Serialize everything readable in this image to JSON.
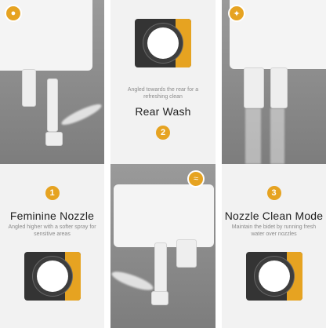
{
  "panels": {
    "feminine": {
      "number": "1",
      "title": "Feminine Nozzle",
      "description": "Angled higher with a softer spray for sensitive areas",
      "badge_icon": "water-drop-icon"
    },
    "rear": {
      "number": "2",
      "title": "Rear Wash",
      "description": "Angled towards the rear for a refreshing clean",
      "badge_icon": "wave-icon"
    },
    "clean": {
      "number": "3",
      "title": "Nozzle Clean Mode",
      "description": "Maintain the bidet by running fresh water over nozzles",
      "badge_icon": "self-clean-icon"
    }
  },
  "colors": {
    "accent": "#e6a321",
    "panel": "#343434",
    "card": "#f2f2f2",
    "photo": "#8a8a8a"
  }
}
